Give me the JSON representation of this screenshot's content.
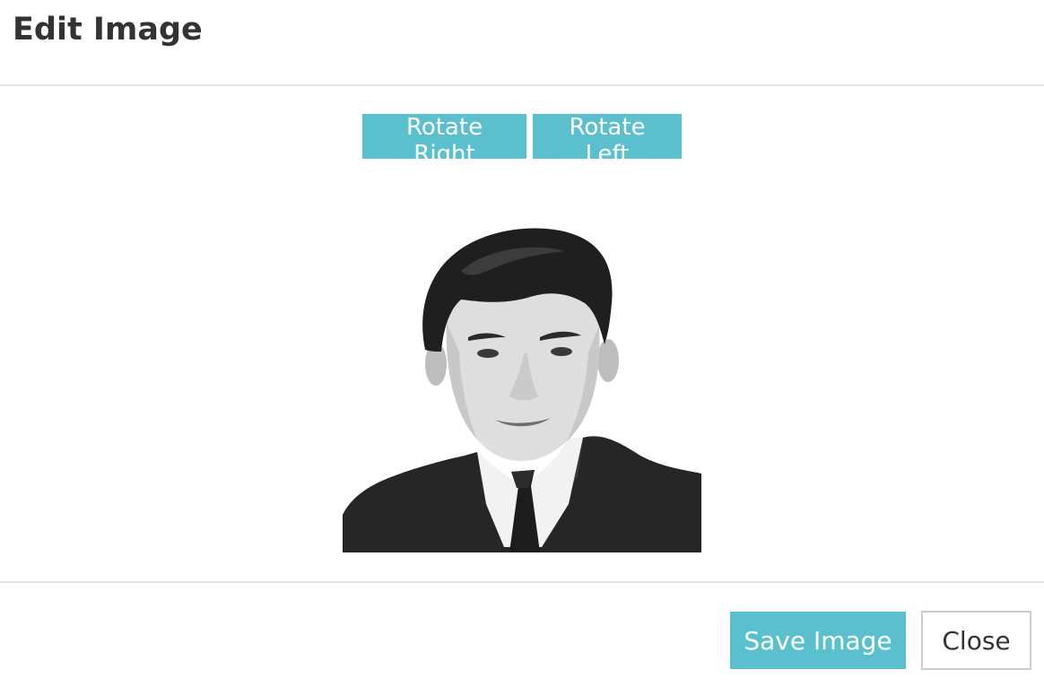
{
  "dialog": {
    "title": "Edit Image"
  },
  "toolbar": {
    "rotate_right_label": "Rotate Right",
    "rotate_left_label": "Rotate Left"
  },
  "image": {
    "subject": "grayscale headshot portrait of a young man in a dark suit, white shirt and dark tie"
  },
  "footer": {
    "save_label": "Save Image",
    "close_label": "Close"
  },
  "colors": {
    "accent": "#5bc0ce",
    "divider": "#e5e5e5",
    "close_border": "#cccccc",
    "title_text": "#333333"
  }
}
